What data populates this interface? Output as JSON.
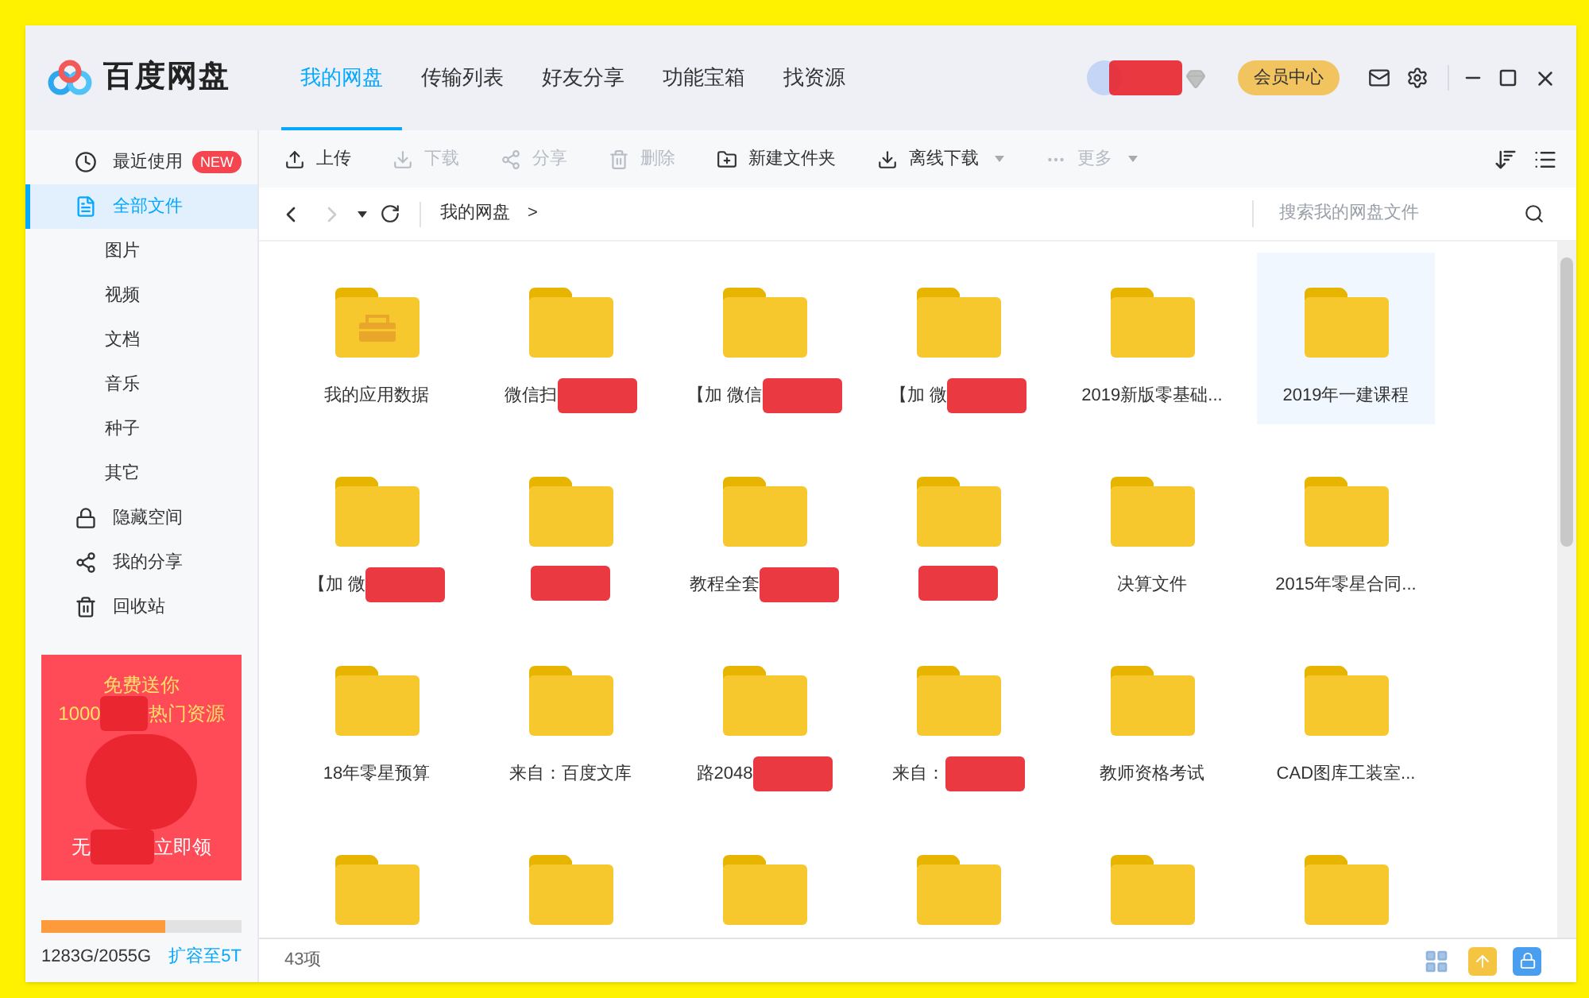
{
  "app": {
    "name": "百度网盘"
  },
  "tabs": [
    {
      "label": "我的网盘",
      "selected": true
    },
    {
      "label": "传输列表",
      "selected": false
    },
    {
      "label": "好友分享",
      "selected": false
    },
    {
      "label": "功能宝箱",
      "selected": false
    },
    {
      "label": "找资源",
      "selected": false
    }
  ],
  "header": {
    "vip_button": "会员中心",
    "account_redacted": true
  },
  "sidebar": {
    "items": [
      {
        "label": "最近使用",
        "badge": "NEW",
        "selected": false
      },
      {
        "label": "全部文件",
        "selected": true,
        "children": [
          {
            "label": "图片",
            "selected": false
          },
          {
            "label": "视频",
            "selected": false
          },
          {
            "label": "文档",
            "selected": false
          },
          {
            "label": "音乐",
            "selected": false
          },
          {
            "label": "种子",
            "selected": false
          },
          {
            "label": "其它",
            "selected": false
          }
        ]
      },
      {
        "label": "隐藏空间",
        "selected": false
      },
      {
        "label": "我的分享",
        "selected": false
      },
      {
        "label": "回收站",
        "selected": false
      }
    ]
  },
  "ad": {
    "title": "免费送你",
    "line_start": "1000",
    "line_end": "热门资源",
    "footer_start": "无",
    "footer_end": "立即领"
  },
  "storage": {
    "text": "1283G/2055G",
    "level": 0.62,
    "link": "扩容至5T"
  },
  "toolbar": {
    "actions": [
      {
        "label": "上传",
        "disabled": false,
        "dropdown": false
      },
      {
        "label": "下载",
        "disabled": true,
        "dropdown": false
      },
      {
        "label": "分享",
        "disabled": true,
        "dropdown": false
      },
      {
        "label": "删除",
        "disabled": true,
        "dropdown": false
      },
      {
        "label": "新建文件夹",
        "disabled": false,
        "dropdown": false
      },
      {
        "label": "离线下载",
        "disabled": false,
        "dropdown": true
      },
      {
        "label": "更多",
        "disabled": true,
        "dropdown": true
      }
    ]
  },
  "nav": {
    "back_disabled": false,
    "forward_disabled": true
  },
  "breadcrumb": {
    "items": [
      "我的网盘"
    ],
    "separator": ">"
  },
  "search": {
    "placeholder": "搜索我的网盘文件"
  },
  "files": [
    {
      "name": "我的应用数据",
      "kind": "app_folder",
      "selected": false,
      "redacted": false
    },
    {
      "name": "微信扫",
      "kind": "folder",
      "selected": false,
      "redacted": true
    },
    {
      "name": "【加 微信",
      "kind": "folder",
      "selected": false,
      "redacted": true
    },
    {
      "name": "【加 微",
      "kind": "folder",
      "selected": false,
      "redacted": true
    },
    {
      "name": "2019新版零基础...",
      "kind": "folder",
      "selected": false,
      "redacted": false
    },
    {
      "name": "2019年一建课程",
      "kind": "folder",
      "selected": true,
      "redacted": false
    },
    {
      "name": "【加 微",
      "kind": "folder",
      "selected": false,
      "redacted": true
    },
    {
      "kind": "folder",
      "selected": false,
      "redacted": true
    },
    {
      "name": "教程全套",
      "kind": "folder",
      "selected": false,
      "redacted": true
    },
    {
      "kind": "folder",
      "selected": false,
      "redacted": true
    },
    {
      "name": "决算文件",
      "kind": "folder",
      "selected": false,
      "redacted": false
    },
    {
      "name": "2015年零星合同...",
      "kind": "folder",
      "selected": false,
      "redacted": false
    },
    {
      "name": "18年零星预算",
      "kind": "folder",
      "selected": false,
      "redacted": false
    },
    {
      "name": "来自：百度文库",
      "kind": "folder",
      "selected": false,
      "redacted": false
    },
    {
      "name": "路2048",
      "kind": "folder",
      "selected": false,
      "redacted": true
    },
    {
      "name": "来自：",
      "kind": "folder",
      "selected": false,
      "redacted": true
    },
    {
      "name": "教师资格考试",
      "kind": "folder",
      "selected": false,
      "redacted": false
    },
    {
      "name": "CAD图库工装室...",
      "kind": "folder",
      "selected": false,
      "redacted": false
    },
    {
      "kind": "folder",
      "selected": false,
      "redacted": false
    },
    {
      "kind": "folder",
      "selected": false,
      "redacted": false
    },
    {
      "kind": "folder",
      "selected": false,
      "redacted": false
    },
    {
      "kind": "folder",
      "selected": false,
      "redacted": false
    },
    {
      "kind": "folder",
      "selected": false,
      "redacted": false
    },
    {
      "kind": "folder",
      "selected": false,
      "redacted": false
    }
  ],
  "status_bar": {
    "count": "43项"
  }
}
